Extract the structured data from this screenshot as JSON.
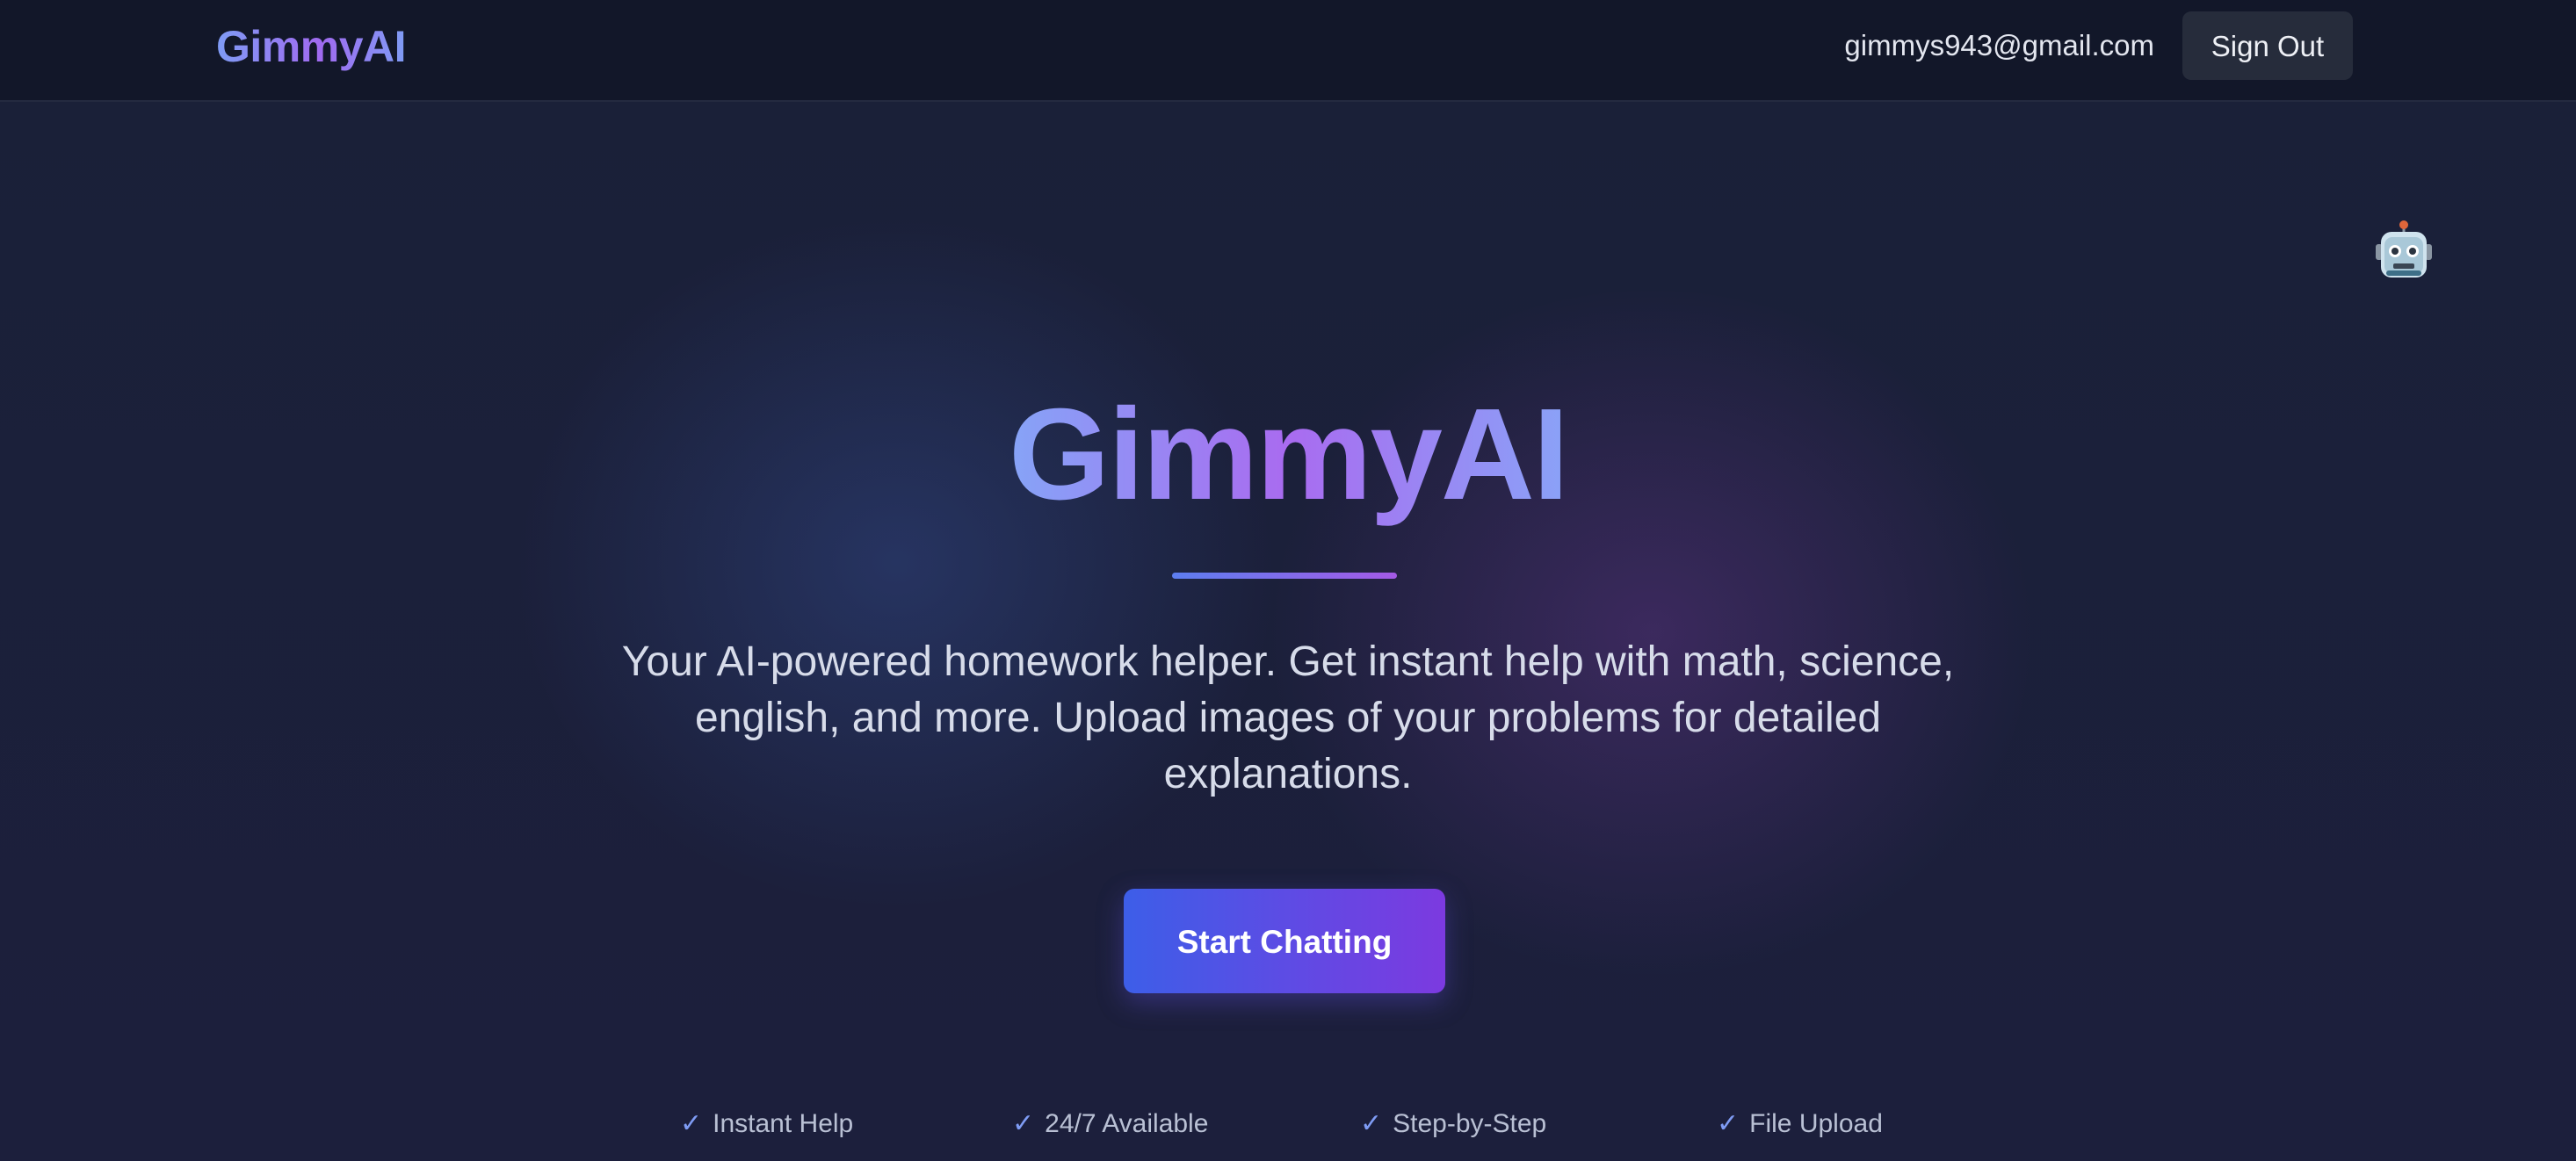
{
  "header": {
    "brand": "GimmyAI",
    "user_email": "gimmys943@gmail.com",
    "sign_out_label": "Sign Out"
  },
  "hero": {
    "title": "GimmyAI",
    "subtitle": "Your AI-powered homework helper. Get instant help with math, science, english, and more. Upload images of your problems for detailed explanations.",
    "cta_label": "Start Chatting"
  },
  "features": [
    {
      "check": "✓",
      "label": "Instant Help"
    },
    {
      "check": "✓",
      "label": "24/7 Available"
    },
    {
      "check": "✓",
      "label": "Step-by-Step"
    },
    {
      "check": "✓",
      "label": "File Upload"
    }
  ],
  "icons": {
    "robot": "robot-icon",
    "check": "check-icon"
  },
  "colors": {
    "background": "#1b2039",
    "header_background": "#121729",
    "brand_gradient_start": "#7f9cf5",
    "brand_gradient_end": "#a06af0",
    "cta_gradient_start": "#3d5ee8",
    "cta_gradient_end": "#7c3ae0",
    "sign_out_background": "#262c3b"
  }
}
